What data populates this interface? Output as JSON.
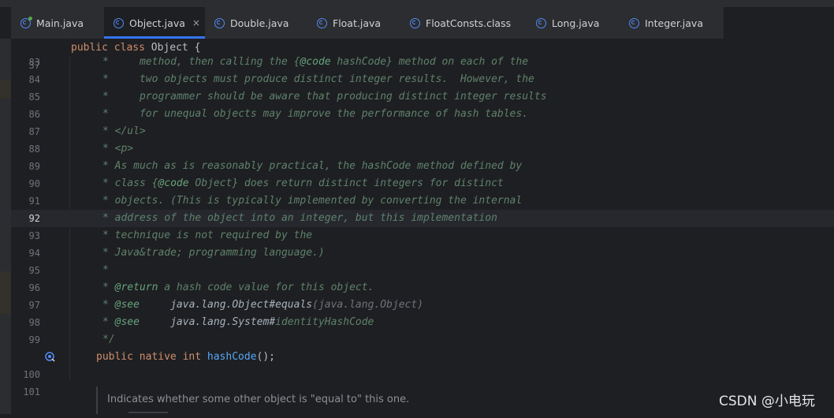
{
  "tabs": [
    {
      "label": "Main.java",
      "icon": "java-class-main-icon",
      "active": false
    },
    {
      "label": "Object.java",
      "icon": "java-class-icon",
      "active": true
    },
    {
      "label": "Double.java",
      "icon": "java-class-icon",
      "active": false
    },
    {
      "label": "Float.java",
      "icon": "java-class-icon",
      "active": false
    },
    {
      "label": "FloatConsts.class",
      "icon": "java-class-icon",
      "active": false
    },
    {
      "label": "Long.java",
      "icon": "java-class-icon",
      "active": false
    },
    {
      "label": "Integer.java",
      "icon": "java-class-icon",
      "active": false
    }
  ],
  "close_glyph": "×",
  "sticky_header": {
    "line": "37",
    "kw1": "public",
    "kw2": "class",
    "name": "Object",
    "brace": "{"
  },
  "lines": [
    {
      "num": "83",
      "star": "*",
      "text": "     method, then calling the {",
      "tag": "@code",
      "rest": " hashCode} method on each of the"
    },
    {
      "num": "84",
      "star": "*",
      "text": "     two objects must produce distinct integer results.  However, the"
    },
    {
      "num": "85",
      "star": "*",
      "text": "     programmer should be aware that producing distinct integer results"
    },
    {
      "num": "86",
      "star": "*",
      "text": "     for unequal objects may improve the performance of hash tables."
    },
    {
      "num": "87",
      "star": "*",
      "text": " </ul>"
    },
    {
      "num": "88",
      "star": "*",
      "text": " <p>"
    },
    {
      "num": "89",
      "star": "*",
      "text": " As much as is reasonably practical, the hashCode method defined by"
    },
    {
      "num": "90",
      "star": "*",
      "text": " class {",
      "tag": "@code",
      "rest": " Object} does return distinct integers for distinct"
    },
    {
      "num": "91",
      "star": "*",
      "text": " objects. (This is typically implemented by converting the internal"
    },
    {
      "num": "92",
      "star": "*",
      "text": " address of the object into an integer, but this implementation"
    },
    {
      "num": "93",
      "star": "*",
      "text": " technique is not required by the"
    },
    {
      "num": "94",
      "star": "*",
      "text": " Java&trade; programming language.)"
    },
    {
      "num": "95",
      "star": "*",
      "text": ""
    },
    {
      "num": "96",
      "star": "*",
      "text": " ",
      "tag": "@return",
      "rest": " a hash code value for this object."
    },
    {
      "num": "97",
      "star": "*",
      "text": " ",
      "tag": "@see",
      "see_ref": "     java.lang.Object#",
      "see_ref2": "equals",
      "see_rest": "(java.lang.Object)"
    },
    {
      "num": "98",
      "star": "*",
      "text": " ",
      "tag": "@see",
      "see_ref": "     java.lang.System#",
      "see_rest": "identityHashCode"
    },
    {
      "num": "99",
      "star": "*/",
      "text": ""
    }
  ],
  "method_line": {
    "num": "100",
    "kw1": "public",
    "kw2": "native",
    "kw3": "int",
    "name": "hashCode",
    "tail": "();"
  },
  "empty_line": {
    "num": "101"
  },
  "current_line": "92",
  "doc_hint": "Indicates whether some other object is \"equal to\" this one.",
  "watermark": "CSDN @小电玩",
  "colors": {
    "accent": "#3574f0",
    "keyword": "#cf8e6d",
    "comment": "#5f826b",
    "method": "#56a8f5"
  }
}
